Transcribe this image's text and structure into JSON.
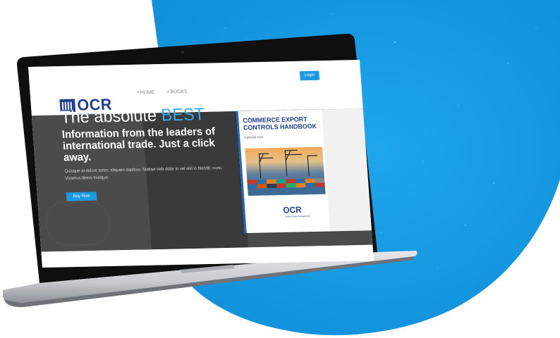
{
  "colors": {
    "brand_blue": "#1f3f8f",
    "accent_blue": "#1e9be0",
    "blob_blue": "#169be2",
    "hero_gray": "#4b4b4b"
  },
  "site": {
    "logo_text": "OCR",
    "logo_subtext": "Global Trade Management"
  },
  "nav": {
    "items": [
      "HOME",
      "BOOKS"
    ]
  },
  "header": {
    "login_label": "Login"
  },
  "hero": {
    "headline_prefix": "The absolute ",
    "headline_highlight": "BEST",
    "subheadline": "Information from the leaders of international trade. Just a click away.",
    "paragraph": "Quisque at dolore tortor, aliquam dapibus. Mattae velit dolor in vel nisl in blandit, nunc. Vivamus libero tristique.",
    "button_label": "Buy Now"
  },
  "book": {
    "title": "COMMERCE EXPORT CONTROLS HANDBOOK",
    "edition": "Published 2020",
    "logo_text": "OCR",
    "logo_subtext": "Global Trade Management"
  },
  "icons": {
    "logo": "ocr-columns-icon",
    "camera": "webcam-icon"
  }
}
